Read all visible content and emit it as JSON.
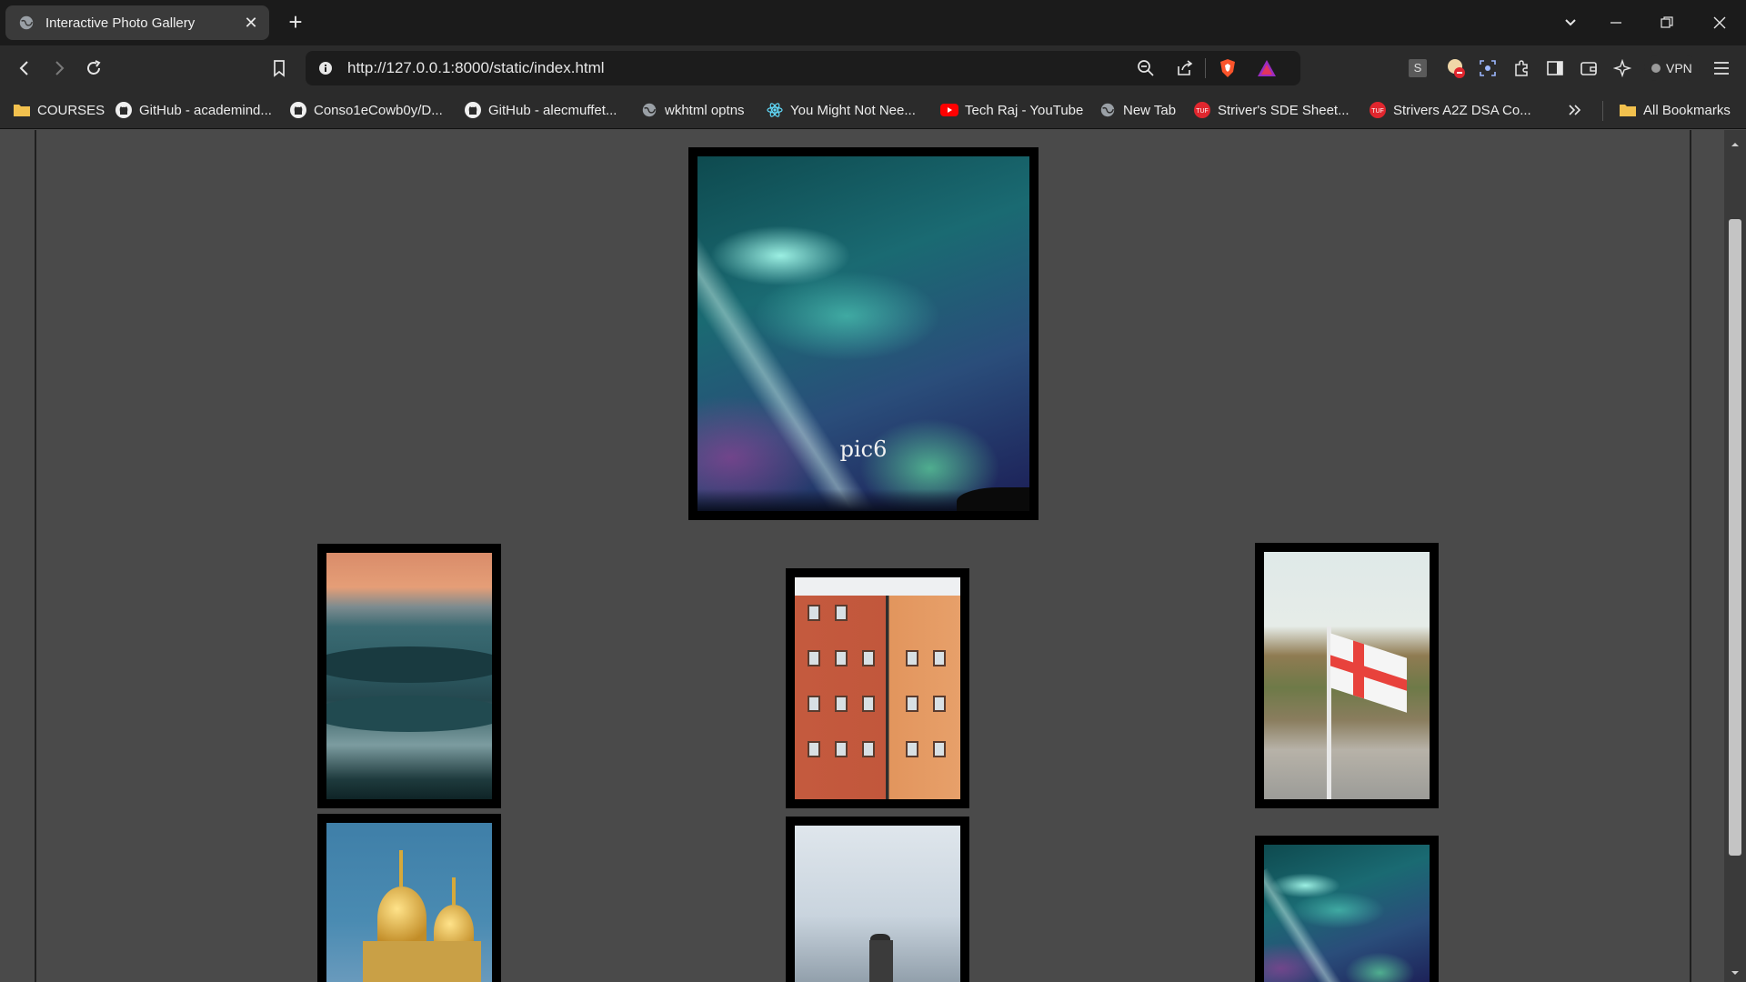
{
  "browser": {
    "tab": {
      "title": "Interactive Photo Gallery",
      "icon": "globe-icon"
    },
    "address": {
      "url": "http://127.0.0.1:8000/static/index.html"
    },
    "vpn_label": "VPN",
    "bookmarks": [
      {
        "label": "COURSES",
        "icon": "folder-icon"
      },
      {
        "label": "GitHub - academind...",
        "icon": "github-icon"
      },
      {
        "label": "Conso1eCowb0y/D...",
        "icon": "github-icon"
      },
      {
        "label": "GitHub - alecmuffet...",
        "icon": "github-icon"
      },
      {
        "label": "wkhtml optns",
        "icon": "globe-icon"
      },
      {
        "label": "You Might Not Nee...",
        "icon": "react-icon"
      },
      {
        "label": "Tech Raj - YouTube",
        "icon": "youtube-icon"
      },
      {
        "label": "New Tab",
        "icon": "globe-icon"
      },
      {
        "label": "Striver's SDE Sheet...",
        "icon": "tuf-icon"
      },
      {
        "label": "Strivers A2Z DSA Co...",
        "icon": "tuf-icon"
      }
    ],
    "all_bookmarks": "All Bookmarks"
  },
  "gallery": {
    "featured": {
      "caption": "pic6",
      "scene": "aurora"
    },
    "thumbnails": [
      {
        "scene": "misty-valley"
      },
      {
        "scene": "colorful-buildings"
      },
      {
        "scene": "flag-on-hill"
      },
      {
        "scene": "golden-domes"
      },
      {
        "scene": "lighthouse"
      },
      {
        "scene": "aurora"
      }
    ]
  },
  "colors": {
    "page_bg": "#4a4a4a",
    "frame": "#000000",
    "chrome_bg": "#2b2b2b",
    "tabstrip_bg": "#1b1b1b"
  }
}
